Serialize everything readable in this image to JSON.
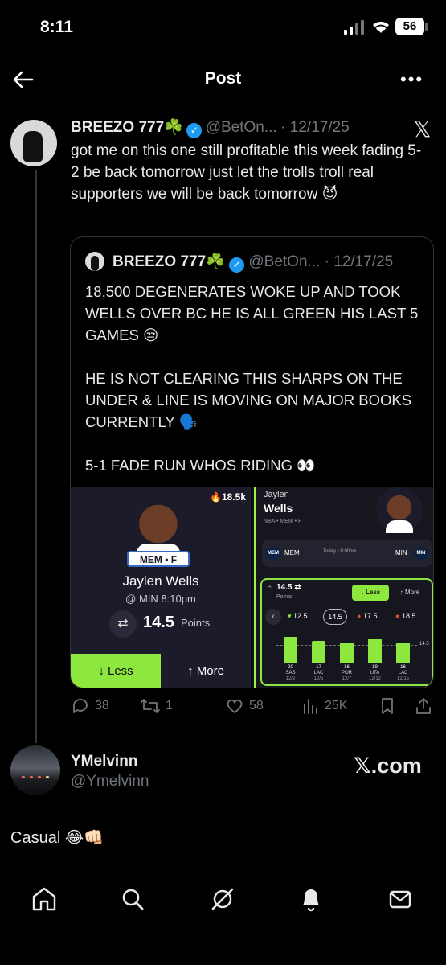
{
  "status": {
    "time": "8:11",
    "battery": "56"
  },
  "header": {
    "title": "Post",
    "more": "•••"
  },
  "post": {
    "author": "BREEZO 777☘️",
    "handle": "@BetOn...",
    "date": "· 12/17/25",
    "text": "got me on this one still profitable this week fading 5-2 be back tomorrow just let the trolls troll real supporters we will be back tomorrow 😈",
    "source_icon": "x-logo"
  },
  "quote": {
    "author": "BREEZO 777☘️",
    "handle": "@BetOn...",
    "date": "· 12/17/25",
    "paragraphs": [
      "18,500 DEGENERATES WOKE UP AND TOOK WELLS OVER BC HE IS ALL GREEN HIS LAST 5 GAMES 😒",
      "HE IS NOT CLEARING THIS SHARPS ON THE UNDER & LINE IS MOVING ON MAJOR BOOKS CURRENTLY 🗣️",
      "5-1 FADE RUN WHOS RIDING 👀"
    ],
    "card_left": {
      "pick_count": "🔥18.5k",
      "team_badge": "MEM • F",
      "player": "Jaylen Wells",
      "matchup_prefix": "@ MIN",
      "time": "8:10pm",
      "line": "14.5",
      "stat": "Points",
      "less": "↓ Less",
      "more": "↑ More"
    },
    "card_right": {
      "first": "Jaylen",
      "last": "Wells",
      "meta": "NBA • MEM • F",
      "team_a_badge": "MEM",
      "team_a": "MEM",
      "game_time": "Today • 8:00pm",
      "team_b": "MIN",
      "team_b_badge": "MIN",
      "line": "14.5 ⇄",
      "stat": "Points",
      "less": "↓ Less",
      "more": "↑ More",
      "chips": [
        "12.5",
        "14.5",
        "17.5",
        "18.5"
      ],
      "ref_line": "14.5",
      "games": [
        {
          "value": 20,
          "opp": "SAS",
          "date": "12/2"
        },
        {
          "value": 17,
          "opp": "LAC",
          "date": "12/5"
        },
        {
          "value": 16,
          "opp": "POR",
          "date": "12/7"
        },
        {
          "value": 19,
          "opp": "UTA",
          "date": "12/12"
        },
        {
          "value": 16,
          "opp": "LAC",
          "date": "12/15"
        }
      ]
    }
  },
  "actions": {
    "replies": "38",
    "reposts": "1",
    "likes": "58",
    "views": "25K"
  },
  "reply": {
    "author": "YMelvinn",
    "handle": "@Ymelvinn",
    "source": "𝕏.com",
    "text": "Casual 😂👊🏻"
  },
  "colors": {
    "accent": "#1d9bf0",
    "bet_green": "#8ee73f",
    "muted": "#71767b"
  }
}
